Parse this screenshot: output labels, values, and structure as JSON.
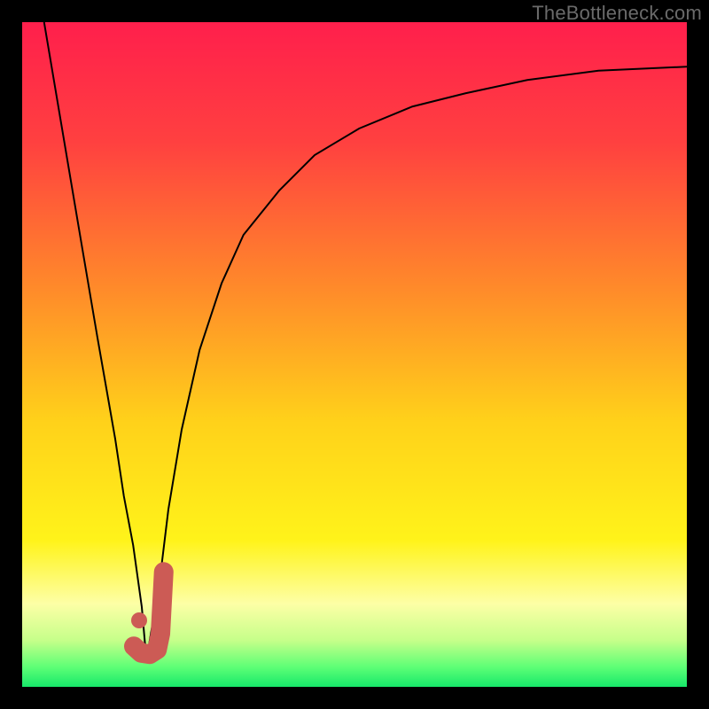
{
  "watermark": "TheBottleneck.com",
  "colors": {
    "background": "#000000",
    "gradient_stops": [
      {
        "offset": 0.0,
        "color": "#ff1f4c"
      },
      {
        "offset": 0.18,
        "color": "#ff4040"
      },
      {
        "offset": 0.4,
        "color": "#ff8a2a"
      },
      {
        "offset": 0.6,
        "color": "#ffd11a"
      },
      {
        "offset": 0.78,
        "color": "#fff31a"
      },
      {
        "offset": 0.875,
        "color": "#fdffa6"
      },
      {
        "offset": 0.93,
        "color": "#c6ff8a"
      },
      {
        "offset": 0.97,
        "color": "#5eff76"
      },
      {
        "offset": 1.0,
        "color": "#17e86a"
      }
    ],
    "curve": "#000000",
    "marker": "#cc5b55"
  },
  "chart_data": {
    "type": "line",
    "title": "",
    "xlabel": "",
    "ylabel": "",
    "xlim": [
      0,
      100
    ],
    "ylim": [
      0,
      100
    ],
    "grid": false,
    "legend": false,
    "series": [
      {
        "name": "left-branch",
        "x": [
          3.3,
          6.0,
          8.7,
          11.3,
          14.0,
          15.3,
          16.7,
          18.0,
          18.7
        ],
        "y": [
          100.0,
          84.0,
          68.0,
          52.7,
          37.3,
          28.7,
          21.3,
          12.0,
          4.0
        ]
      },
      {
        "name": "right-branch",
        "x": [
          18.7,
          20.7,
          22.0,
          24.0,
          26.7,
          30.0,
          33.3,
          38.7,
          44.0,
          50.7,
          58.7,
          66.7,
          76.0,
          86.7,
          100.0
        ],
        "y": [
          4.0,
          16.0,
          26.7,
          38.7,
          50.7,
          60.7,
          68.0,
          74.7,
          80.0,
          84.0,
          87.3,
          89.3,
          91.3,
          92.7,
          93.3
        ]
      }
    ],
    "marker": {
      "name": "J-shaped-marker",
      "dot": {
        "x": 17.6,
        "y": 10.0
      },
      "stroke_path": [
        {
          "x": 21.3,
          "y": 17.3
        },
        {
          "x": 20.8,
          "y": 8.0
        },
        {
          "x": 20.3,
          "y": 5.6
        },
        {
          "x": 19.2,
          "y": 4.9
        },
        {
          "x": 17.9,
          "y": 5.1
        },
        {
          "x": 16.8,
          "y": 6.1
        }
      ]
    },
    "background_gradient": "vertical heat gradient, red at top to green at bottom"
  }
}
